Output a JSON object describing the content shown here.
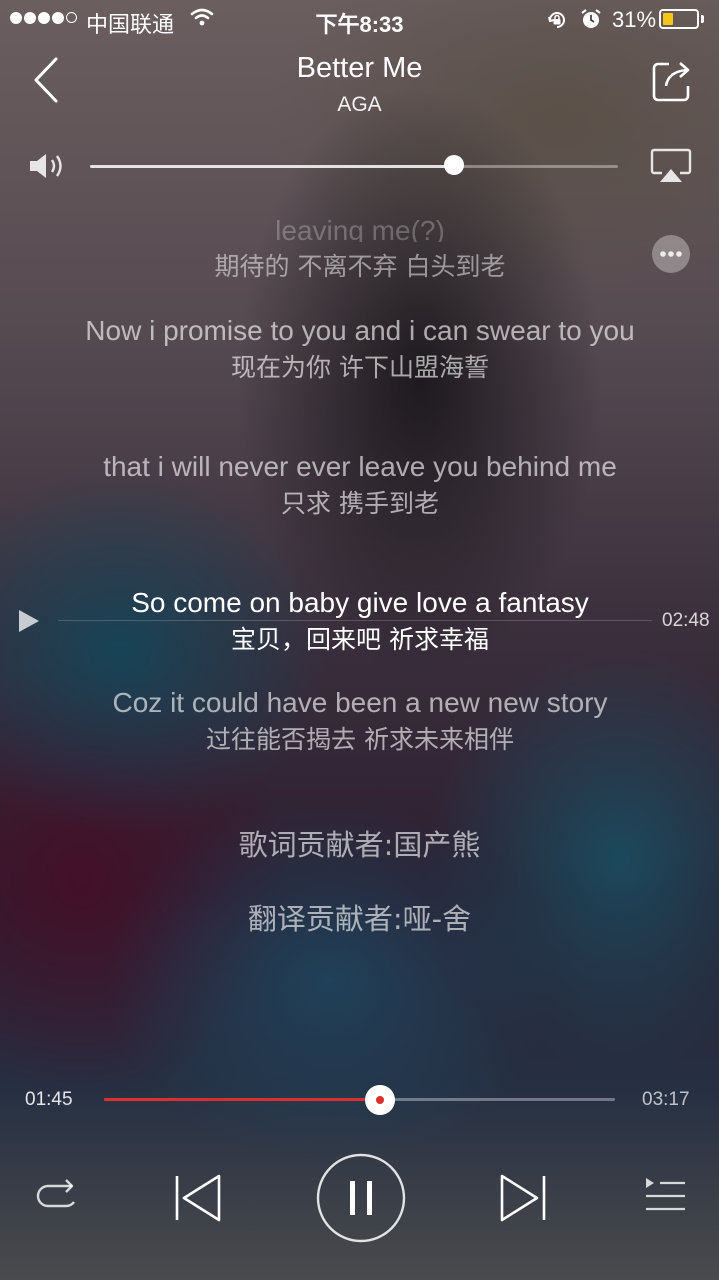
{
  "status_bar": {
    "carrier": "中国联通",
    "time": "下午8:33",
    "battery_percent": "31%",
    "battery_level": 0.31,
    "signal_bars_filled": 4,
    "signal_bars_total": 5
  },
  "header": {
    "title": "Better Me",
    "artist": "AGA",
    "icons": {
      "back": "back-chevron-icon",
      "share": "share-icon",
      "airplay": "airplay-icon",
      "more": "more-icon",
      "volume": "speaker-icon"
    }
  },
  "volume": {
    "level": 0.69
  },
  "lyrics": {
    "partial_top_en": "leaving me(?)",
    "lines": [
      {
        "en": "",
        "zh": "期待的 不离不弃 白头到老"
      },
      {
        "en": "Now i promise to you and i can swear to you",
        "zh": "现在为你  许下山盟海誓"
      },
      {
        "en": "that i will never ever leave you behind me",
        "zh": "只求 携手到老"
      },
      {
        "en": "So come on baby give love a fantasy",
        "zh": "宝贝，回来吧   祈求幸福"
      },
      {
        "en": "Coz it could have been a new new story",
        "zh": "过往能否揭去  祈求未来相伴"
      }
    ],
    "current_index": 3,
    "current_line_time": "02:48",
    "credit_lyrics": "歌词贡献者:国产熊",
    "credit_translation": "翻译贡献者:哑-舍"
  },
  "playback": {
    "elapsed": "01:45",
    "duration": "03:17",
    "progress": 0.54,
    "accent_color": "#d9312d",
    "controls": {
      "repeat": "repeat-icon",
      "previous": "previous-track-icon",
      "pause": "pause-icon",
      "next": "next-track-icon",
      "playlist": "playlist-icon"
    }
  }
}
